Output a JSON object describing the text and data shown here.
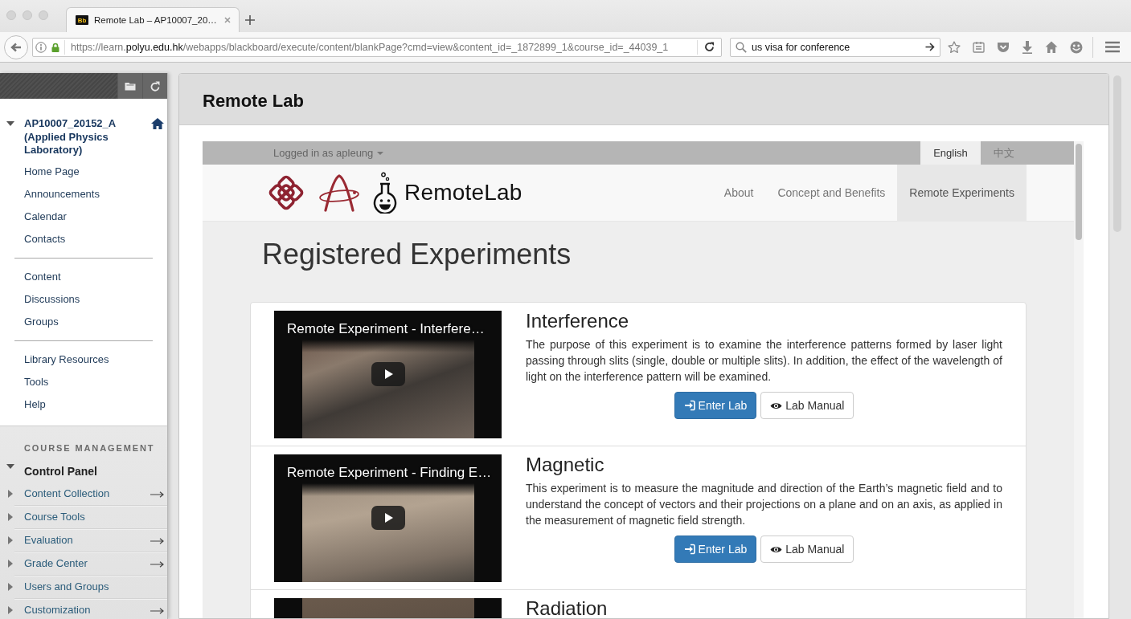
{
  "browser": {
    "tab": {
      "favicon": "Bb",
      "title": "Remote Lab – AP10007_20…",
      "selected": true
    },
    "address_bar": {
      "url_parts": [
        {
          "text": "https://learn.",
          "highlight": false
        },
        {
          "text": "polyu.edu.hk",
          "highlight": true
        },
        {
          "text": "/webapps/blackboard/execute/content/blankPage?cmd=view&content_id=_1872899_1&course_id=_44039_1",
          "highlight": false
        }
      ]
    },
    "search": {
      "value": "us visa for conference"
    }
  },
  "course_menu": {
    "title": "AP10007_20152_A (Applied Physics Laboratory)",
    "expanded": true,
    "sections": [
      {
        "items": [
          "Home Page",
          "Announcements",
          "Calendar",
          "Contacts"
        ]
      },
      {
        "items": [
          "Content",
          "Discussions",
          "Groups"
        ]
      },
      {
        "items": [
          "Library Resources",
          "Tools",
          "Help"
        ]
      }
    ]
  },
  "course_management": {
    "heading": "COURSE MANAGEMENT",
    "control_panel": {
      "title": "Control Panel",
      "expanded": true,
      "items": [
        {
          "label": "Content Collection",
          "expanded": false,
          "arrow": true
        },
        {
          "label": "Course Tools",
          "expanded": false,
          "arrow": false
        },
        {
          "label": "Evaluation",
          "expanded": false,
          "arrow": true
        },
        {
          "label": "Grade Center",
          "expanded": false,
          "arrow": true
        },
        {
          "label": "Users and Groups",
          "expanded": false,
          "arrow": false
        },
        {
          "label": "Customization",
          "expanded": false,
          "arrow": true
        }
      ]
    }
  },
  "content": {
    "title": "Remote Lab",
    "embed": {
      "user_menu": "Logged in as apleung",
      "languages": [
        {
          "label": "English",
          "selected": true
        },
        {
          "label": "中文",
          "selected": false
        }
      ],
      "brand": "RemoteLab",
      "nav": [
        {
          "label": "About",
          "selected": false
        },
        {
          "label": "Concept and Benefits",
          "selected": false
        },
        {
          "label": "Remote Experiments",
          "selected": true
        }
      ],
      "heading": "Registered Experiments",
      "experiments": [
        {
          "video_title": "Remote Experiment - Interfere…",
          "title": "Interference",
          "description": "The purpose of this experiment is to examine the interference patterns formed by laser light passing through slits (single, double or multiple slits). In addition, the effect of the wavelength of light on the interference pattern will be examined.",
          "buttons": [
            {
              "label": "Enter Lab",
              "kind": "primary"
            },
            {
              "label": "Lab Manual",
              "kind": "default"
            }
          ]
        },
        {
          "video_title": "Remote Experiment - Finding E…",
          "title": "Magnetic",
          "description": "This experiment is to measure the magnitude and direction of the Earth’s magnetic field and to understand the concept of vectors and their projections on a plane and on an axis, as applied in the measurement of magnetic field strength.",
          "buttons": [
            {
              "label": "Enter Lab",
              "kind": "primary"
            },
            {
              "label": "Lab Manual",
              "kind": "default"
            }
          ]
        },
        {
          "title": "Radiation"
        }
      ]
    }
  }
}
